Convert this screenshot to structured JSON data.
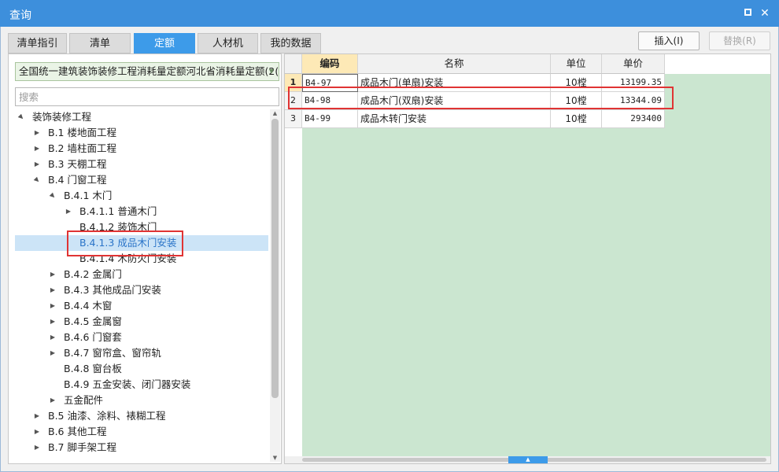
{
  "window": {
    "title": "查询"
  },
  "tabs": [
    {
      "label": "清单指引"
    },
    {
      "label": "清单"
    },
    {
      "label": "定额"
    },
    {
      "label": "人材机"
    },
    {
      "label": "我的数据"
    }
  ],
  "toolbar": {
    "insert_label": "插入(I)",
    "replace_label": "替换(R)"
  },
  "left": {
    "dropdown_value": "全国统一建筑装饰装修工程消耗量定额河北省消耗量定额(2(",
    "search_placeholder": "搜索",
    "tree": [
      {
        "label": "装饰装修工程",
        "toggle": "▲",
        "level": 0
      },
      {
        "label": "B.1 楼地面工程",
        "toggle": "▶",
        "level": 1
      },
      {
        "label": "B.2 墙柱面工程",
        "toggle": "▶",
        "level": 1
      },
      {
        "label": "B.3 天棚工程",
        "toggle": "▶",
        "level": 1
      },
      {
        "label": "B.4 门窗工程",
        "toggle": "▲",
        "level": 1
      },
      {
        "label": "B.4.1 木门",
        "toggle": "▲",
        "level": 2
      },
      {
        "label": "B.4.1.1 普通木门",
        "toggle": "▶",
        "level": 3
      },
      {
        "label": "B.4.1.2 装饰木门",
        "toggle": "",
        "level": 3
      },
      {
        "label": "B.4.1.3 成品木门安装",
        "toggle": "",
        "level": 3,
        "selected": true
      },
      {
        "label": "B.4.1.4 木防火门安装",
        "toggle": "",
        "level": 3
      },
      {
        "label": "B.4.2 金属门",
        "toggle": "▶",
        "level": 2
      },
      {
        "label": "B.4.3 其他成品门安装",
        "toggle": "▶",
        "level": 2
      },
      {
        "label": "B.4.4 木窗",
        "toggle": "▶",
        "level": 2
      },
      {
        "label": "B.4.5 金属窗",
        "toggle": "▶",
        "level": 2
      },
      {
        "label": "B.4.6 门窗套",
        "toggle": "▶",
        "level": 2
      },
      {
        "label": "B.4.7 窗帘盒、窗帘轨",
        "toggle": "▶",
        "level": 2
      },
      {
        "label": "B.4.8 窗台板",
        "toggle": "",
        "level": 2
      },
      {
        "label": "B.4.9 五金安装、闭门器安装",
        "toggle": "",
        "level": 2
      },
      {
        "label": "五金配件",
        "toggle": "▶",
        "level": 2
      },
      {
        "label": "B.5 油漆、涂料、裱糊工程",
        "toggle": "▶",
        "level": 1
      },
      {
        "label": "B.6 其他工程",
        "toggle": "▶",
        "level": 1
      },
      {
        "label": "B.7 脚手架工程",
        "toggle": "▶",
        "level": 1
      }
    ]
  },
  "grid": {
    "columns": [
      "编码",
      "名称",
      "单位",
      "单价"
    ],
    "rows": [
      {
        "num": "1",
        "code": "B4-97",
        "name": "成品木门(单扇)安装",
        "unit": "10樘",
        "price": "13199.35"
      },
      {
        "num": "2",
        "code": "B4-98",
        "name": "成品木门(双扇)安装",
        "unit": "10樘",
        "price": "13344.09"
      },
      {
        "num": "3",
        "code": "B4-99",
        "name": "成品木转门安装",
        "unit": "10樘",
        "price": "293400"
      }
    ]
  },
  "colors": {
    "accent": "#3d9be9",
    "titlebar": "#3d8fdc",
    "highlight": "#e03434",
    "grid_empty": "#cbe6d0",
    "active_header": "#fde9b6"
  }
}
